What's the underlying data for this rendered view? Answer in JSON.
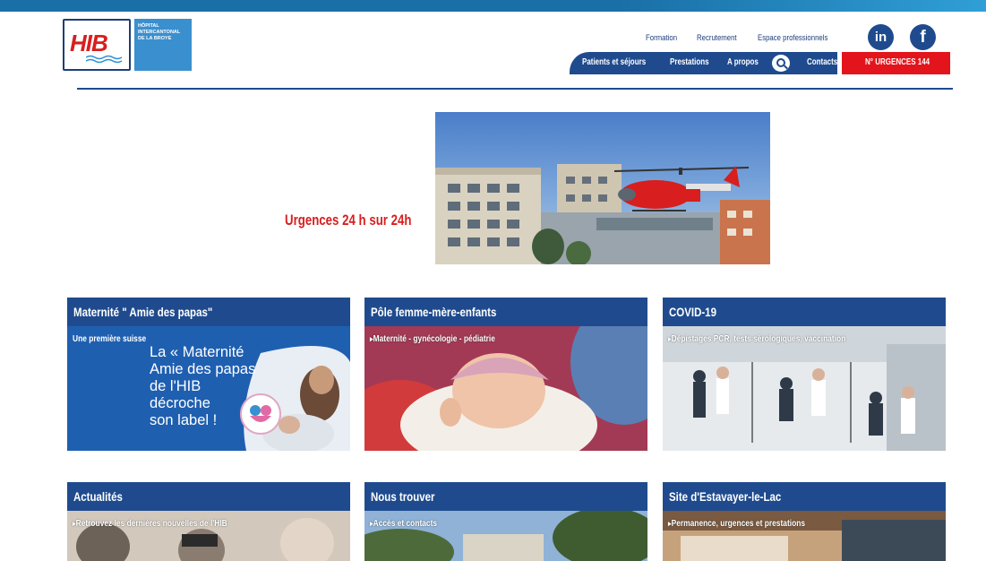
{
  "header": {
    "logo": {
      "mark": "HIB",
      "name_lines": [
        "HÔPITAL",
        "INTERCANTONAL",
        "DE LA BROYE"
      ]
    },
    "util_nav": [
      "Formation",
      "Recrutement",
      "Espace professionnels"
    ],
    "social": {
      "linkedin": "in",
      "facebook": "f"
    },
    "main_nav": [
      "Patients et séjours",
      "Prestations",
      "A propos"
    ],
    "contacts": "Contacts",
    "urgences": "N° URGENCES 144"
  },
  "hero": {
    "text": "Urgences 24 h sur 24h"
  },
  "cards": [
    {
      "title": "Maternité \" Amie des papas\"",
      "sub": "Une première suisse",
      "overlay_lines": [
        "La « Maternité",
        "Amie des papas",
        "de l'HIB",
        "décroche",
        "son label !"
      ]
    },
    {
      "title": "Pôle femme-mère-enfants",
      "sub": "Maternité - gynécologie - pédiatrie"
    },
    {
      "title": "COVID-19",
      "sub": "Dépistages PCR, tests sérologiques, vaccination"
    },
    {
      "title": "Actualités",
      "sub": "Retrouvez les dernières nouvelles de l'HIB"
    },
    {
      "title": "Nous trouver",
      "sub": "Accès et contacts"
    },
    {
      "title": "Site d'Estavayer-le-Lac",
      "sub": "Permanence, urgences et prestations"
    }
  ],
  "colors": {
    "brand_blue": "#1f4b8e",
    "emergency_red": "#e3141b",
    "light_blue": "#3a8fce"
  }
}
